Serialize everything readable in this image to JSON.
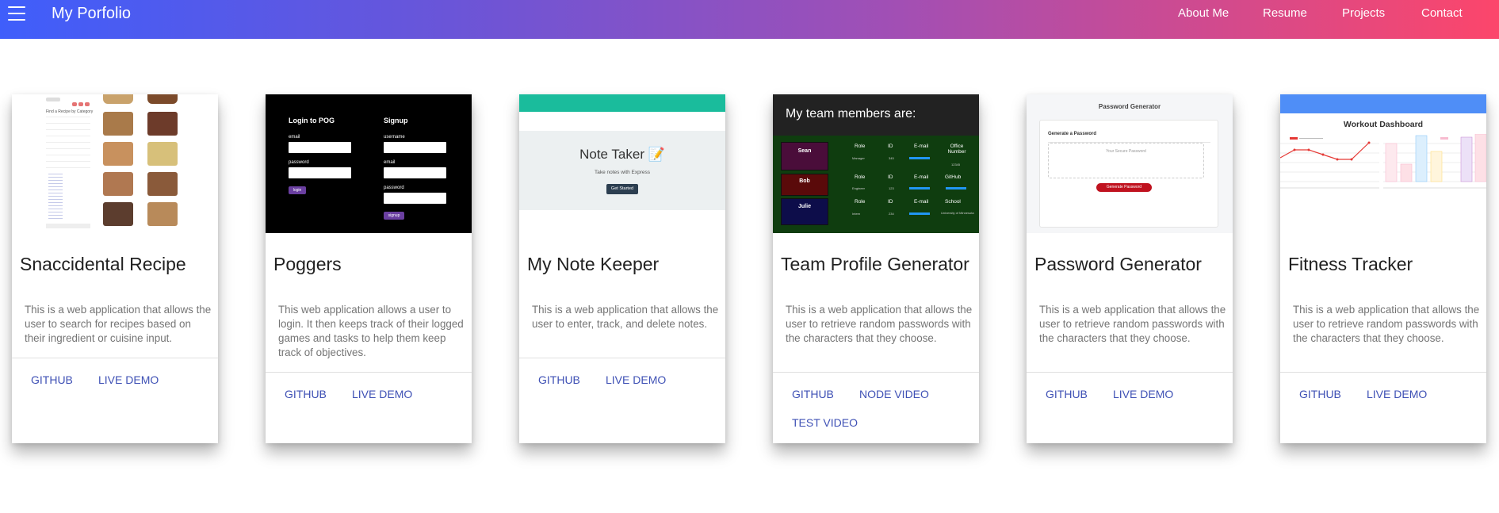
{
  "header": {
    "brand": "My Porfolio",
    "nav": [
      "About Me",
      "Resume",
      "Projects",
      "Contact"
    ]
  },
  "projects": [
    {
      "title": "Snaccidental Recipe",
      "description": "This is a web application that allows the user to search for recipes based on their ingredient or cuisine input.",
      "links": [
        "GITHUB",
        "LIVE DEMO"
      ],
      "thumb": {
        "heading": "Find a Recipe by Category"
      }
    },
    {
      "title": "Poggers",
      "description": "This web application allows a user to login. It then keeps track of their logged games and tasks to help them keep track of objectives.",
      "links": [
        "GITHUB",
        "LIVE DEMO"
      ],
      "thumb": {
        "login_heading": "Login to POG",
        "signup_heading": "Signup",
        "email": "email",
        "password": "password",
        "username": "username",
        "login_btn": "login",
        "signup_btn": "signup"
      }
    },
    {
      "title": "My Note Keeper",
      "description": "This is a web application that allows the user to enter, track, and delete notes.",
      "links": [
        "GITHUB",
        "LIVE DEMO"
      ],
      "thumb": {
        "heading": "Note Taker 📝",
        "sub": "Take notes with Express",
        "btn": "Get Started"
      }
    },
    {
      "title": "Team Profile Generator",
      "description": "This is a web application that allows the user to retrieve random passwords with the characters that they choose.",
      "links": [
        "GITHUB",
        "NODE VIDEO",
        "TEST VIDEO"
      ],
      "thumb": {
        "heading": "My team members are:",
        "members": [
          {
            "name": "Sean",
            "cols": [
              "Role",
              "ID",
              "E-mail",
              "Office Number"
            ],
            "vals": [
              "Manager",
              "345",
              "",
              "12345"
            ]
          },
          {
            "name": "Bob",
            "cols": [
              "Role",
              "ID",
              "E-mail",
              "GitHub"
            ],
            "vals": [
              "Engineer",
              "123",
              "",
              ""
            ]
          },
          {
            "name": "Julie",
            "cols": [
              "Role",
              "ID",
              "E-mail",
              "School"
            ],
            "vals": [
              "Intern",
              "234",
              "",
              "University of Minnesota"
            ]
          }
        ]
      }
    },
    {
      "title": "Password Generator",
      "description": "This is a web application that allows the user to retrieve random passwords with the characters that they choose.",
      "links": [
        "GITHUB",
        "LIVE DEMO"
      ],
      "thumb": {
        "heading": "Password Generator",
        "sub": "Generate a Password",
        "placeholder": "Your Secure Password",
        "btn": "Generate Password"
      }
    },
    {
      "title": "Fitness Tracker",
      "description": "This is a web application that allows the user to retrieve random passwords with the characters that they choose.",
      "links": [
        "GITHUB",
        "LIVE DEMO"
      ],
      "thumb": {
        "heading": "Workout Dashboard"
      }
    }
  ],
  "colors": {
    "gradient_start": "#3f5efb",
    "gradient_end": "#fc466b",
    "link": "#3f51b5",
    "title": "#212121",
    "body_text": "#757575"
  }
}
